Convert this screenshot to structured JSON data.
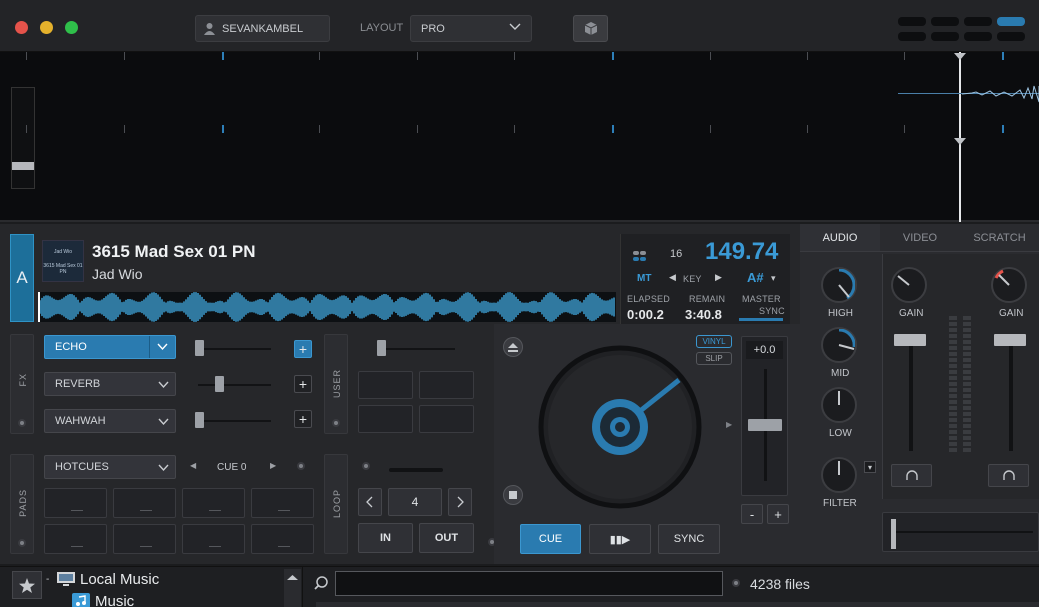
{
  "titlebar": {
    "user": "SEVANKAMBEL",
    "layout_label": "LAYOUT",
    "layout_value": "PRO"
  },
  "deck": {
    "letter": "A",
    "art_artist": "Jad Wio",
    "art_title": "3615 Mad Sex 01 PN",
    "title": "3615 Mad Sex 01 PN",
    "artist": "Jad Wio",
    "bpm": "149.74",
    "beats": "16",
    "mt": "MT",
    "key_label": "KEY",
    "key_value": "A#",
    "elapsed_label": "ELAPSED",
    "elapsed": "0:00.2",
    "remain_label": "REMAIN",
    "remain": "3:40.8",
    "master_label": "MASTER",
    "sync_label": "SYNC",
    "pitch": "+0.0",
    "vinyl": "VINYL",
    "slip": "SLIP"
  },
  "fx": {
    "label": "FX",
    "slots": [
      "ECHO",
      "REVERB",
      "WAHWAH"
    ],
    "echo_active": true
  },
  "user": {
    "label": "USER"
  },
  "pads": {
    "label": "PADS",
    "mode": "HOTCUES",
    "cue": "CUE 0"
  },
  "loop": {
    "label": "LOOP",
    "size": "4",
    "in": "IN",
    "out": "OUT"
  },
  "transport": {
    "cue": "CUE",
    "play": "▮▮▶",
    "sync": "SYNC"
  },
  "mixer": {
    "tabs": [
      "AUDIO",
      "VIDEO",
      "SCRATCH"
    ],
    "knobs": [
      "HIGH",
      "MID",
      "LOW",
      "FILTER"
    ],
    "gain_left": "GAIN",
    "gain_right": "GAIN"
  },
  "browser": {
    "folder": "Local Music",
    "subfolder": "Music",
    "search_placeholder": "",
    "files": "4238 files"
  },
  "colors": {
    "accent": "#2a7bb0",
    "bpm": "#3a9ad6",
    "red": "#e5534b",
    "yellow": "#e4b12c",
    "green": "#2fbf4a"
  }
}
